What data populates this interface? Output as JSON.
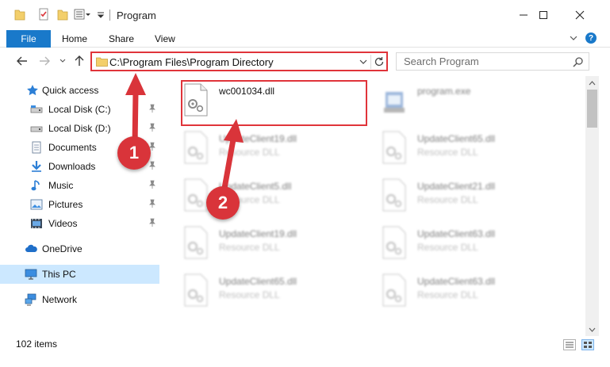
{
  "window": {
    "title": "Program",
    "minimize_glyph": "—",
    "maximize_glyph": "☐",
    "close_glyph": "✕"
  },
  "ribbon": {
    "tabs": [
      {
        "label": "File",
        "active": true
      },
      {
        "label": "Home"
      },
      {
        "label": "Share"
      },
      {
        "label": "View"
      }
    ],
    "help_glyph": "?"
  },
  "navigation": {
    "address": "C:\\Program Files\\Program Directory",
    "search_placeholder": "Search Program"
  },
  "sidebar": {
    "items": [
      {
        "label": "Quick access",
        "icon": "star-icon",
        "pinned": false
      },
      {
        "label": "Local Disk (C:)",
        "icon": "drive-icon",
        "pinned": true
      },
      {
        "label": "Local Disk (D:)",
        "icon": "drive-icon",
        "pinned": true
      },
      {
        "label": "Documents",
        "icon": "documents-icon",
        "pinned": true
      },
      {
        "label": "Downloads",
        "icon": "download-icon",
        "pinned": true
      },
      {
        "label": "Music",
        "icon": "music-icon",
        "pinned": true
      },
      {
        "label": "Pictures",
        "icon": "pictures-icon",
        "pinned": true
      },
      {
        "label": "Videos",
        "icon": "videos-icon",
        "pinned": true
      },
      {
        "label": "OneDrive",
        "icon": "cloud-icon",
        "pinned": false
      },
      {
        "label": "This PC",
        "icon": "computer-icon",
        "pinned": false,
        "selected": true
      },
      {
        "label": "Network",
        "icon": "network-icon",
        "pinned": false
      }
    ]
  },
  "files": [
    {
      "name": "wc001034.dll",
      "type": "",
      "icon": "dll-file-icon",
      "highlighted": true
    },
    {
      "name": "program.exe",
      "type": "",
      "icon": "exe-file-icon"
    },
    {
      "name": "UpdateClient19.dll",
      "type": "Resource DLL",
      "icon": "dll-file-icon"
    },
    {
      "name": "UpdateClient65.dll",
      "type": "Resource DLL",
      "icon": "dll-file-icon"
    },
    {
      "name": "UpdateClient5.dll",
      "type": "Resource DLL",
      "icon": "dll-file-icon"
    },
    {
      "name": "UpdateClient21.dll",
      "type": "Resource DLL",
      "icon": "dll-file-icon"
    },
    {
      "name": "UpdateClient19.dll",
      "type": "Resource DLL",
      "icon": "dll-file-icon"
    },
    {
      "name": "UpdateClient63.dll",
      "type": "Resource DLL",
      "icon": "dll-file-icon"
    },
    {
      "name": "UpdateClient65.dll",
      "type": "Resource DLL",
      "icon": "dll-file-icon"
    },
    {
      "name": "UpdateClient63.dll",
      "type": "Resource DLL",
      "icon": "dll-file-icon"
    }
  ],
  "status": {
    "item_count": "102 items"
  },
  "annotations": {
    "step1": "1",
    "step2": "2",
    "color": "#d9343a"
  },
  "colors": {
    "accent": "#1979ca",
    "highlight_border": "#e0343a",
    "selected_bg": "#cce8ff"
  }
}
